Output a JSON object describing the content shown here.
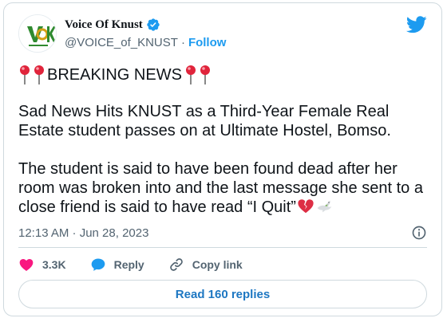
{
  "author": {
    "display_name": "Voice Of Knust",
    "handle": "@VOICE_of_KNUST",
    "separator": "·",
    "follow_label": "Follow",
    "avatar_text": "VOK"
  },
  "tweet": {
    "headline": "BREAKING NEWS",
    "paragraph1": "Sad News Hits KNUST as a Third-Year Female Real Estate student passes on at Ultimate Hostel, Bomso.",
    "paragraph2": "The student is said to have been found dead after her room was broken into and the last message she sent to a close friend is said to have read “I Quit”",
    "emojis": [
      "round-pushpin",
      "broken-heart",
      "dove"
    ]
  },
  "meta": {
    "timestamp": "12:13 AM · Jun 28, 2023"
  },
  "actions": {
    "likes_count": "3.3K",
    "reply_label": "Reply",
    "copy_link_label": "Copy link"
  },
  "footer": {
    "read_replies_label": "Read 160 replies"
  },
  "colors": {
    "brand_blue": "#1d9bf0",
    "like_pink": "#f91880",
    "text_primary": "#0f1419",
    "text_secondary": "#536471",
    "border": "#cfd9de"
  }
}
